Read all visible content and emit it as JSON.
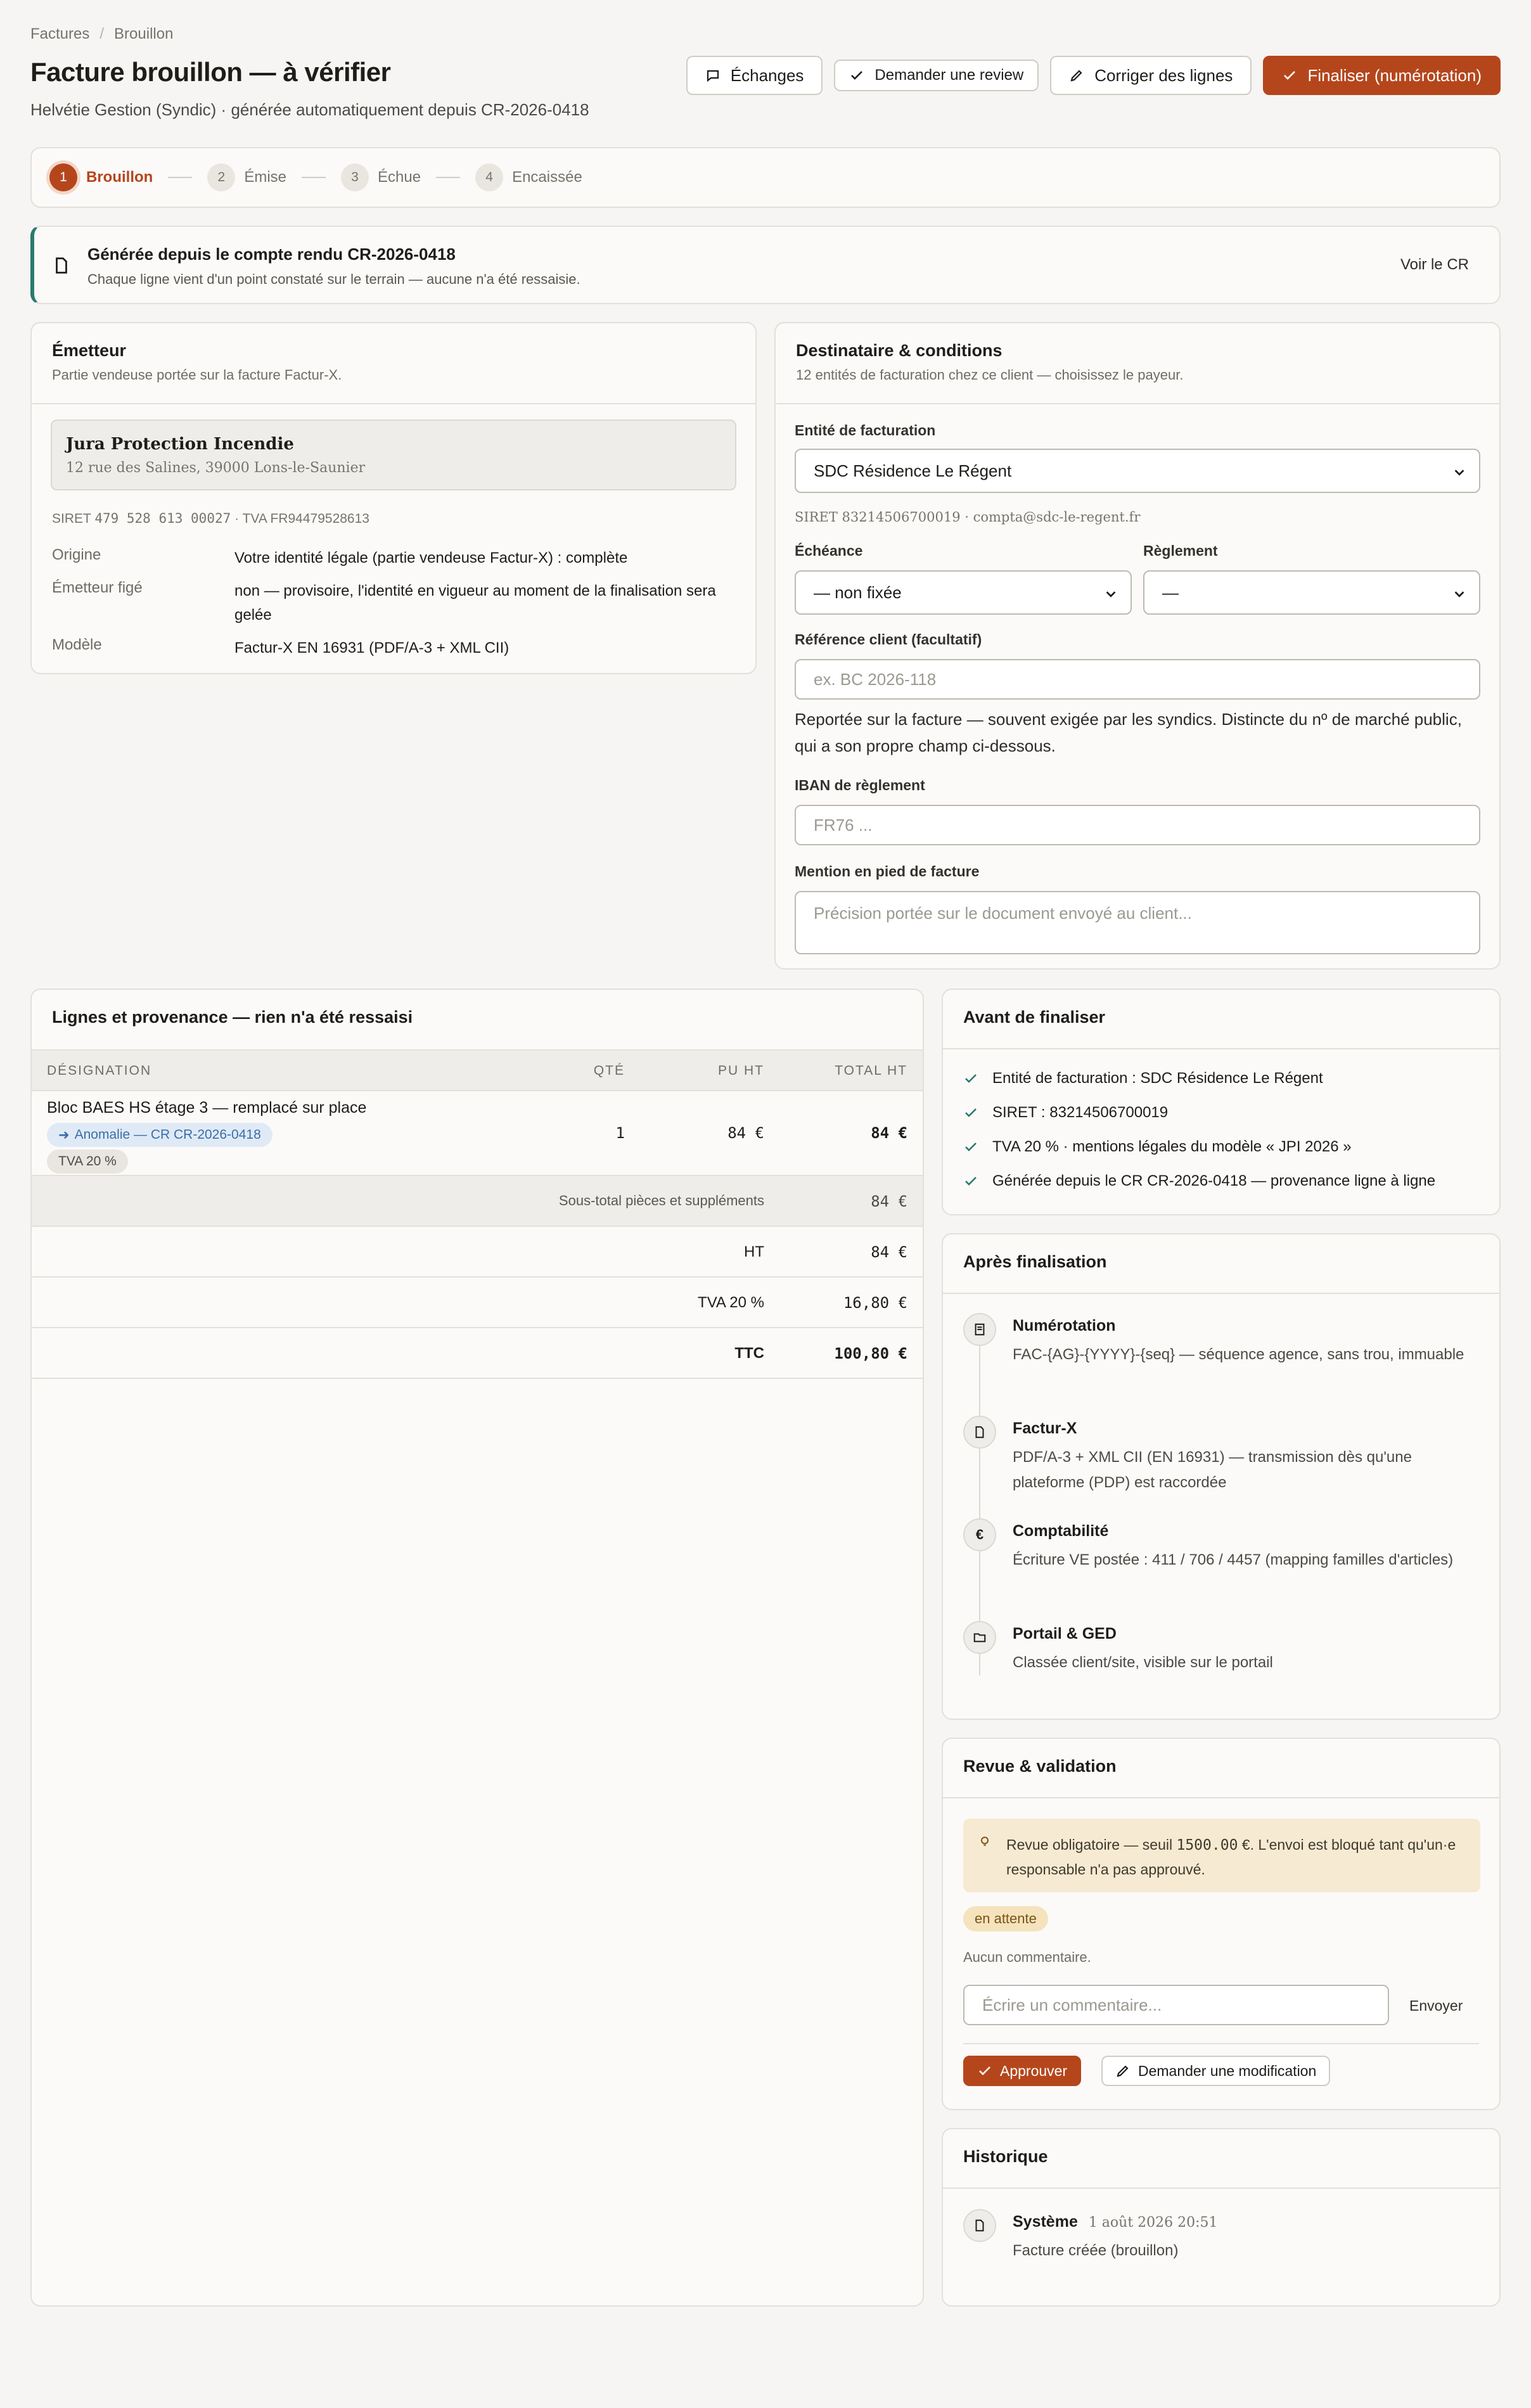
{
  "breadcrumb": {
    "root": "Factures",
    "current": "Brouillon"
  },
  "header": {
    "title": "Facture brouillon — à vérifier",
    "subtitle": "Helvétie Gestion (Syndic) · générée automatiquement depuis CR-2026-0418"
  },
  "toolbar": {
    "exchanges": "Échanges",
    "request_review": "Demander une review",
    "fix_lines": "Corriger des lignes",
    "finalize": "Finaliser (numérotation)"
  },
  "steps": [
    {
      "num": "1",
      "label": "Brouillon"
    },
    {
      "num": "2",
      "label": "Émise"
    },
    {
      "num": "3",
      "label": "Échue"
    },
    {
      "num": "4",
      "label": "Encaissée"
    }
  ],
  "banner": {
    "title": "Générée depuis le compte rendu CR-2026-0418",
    "text": "Chaque ligne vient d'un point constaté sur le terrain — aucune n'a été ressaisie.",
    "link": "Voir le CR"
  },
  "emitter": {
    "title": "Émetteur",
    "desc": "Partie vendeuse portée sur la facture Factur-X.",
    "company": "Jura Protection Incendie",
    "address": "12 rue des Salines, 39000 Lons-le-Saunier",
    "siret_label": "SIRET",
    "siret": "479 528 613 00027",
    "tva": "· TVA FR94479528613",
    "rows": [
      {
        "k": "Origine",
        "v": "Votre identité légale (partie vendeuse Factur-X) : complète"
      },
      {
        "k": "Émetteur figé",
        "v": "non — provisoire, l'identité en vigueur au moment de la finalisation sera gelée"
      },
      {
        "k": "Modèle",
        "v": "Factur-X EN 16931 (PDF/A-3 + XML CII)"
      }
    ]
  },
  "recipient": {
    "title": "Destinataire & conditions",
    "desc": "12 entités de facturation chez ce client — choisissez le payeur.",
    "entity_label": "Entité de facturation",
    "entity_value": "SDC Résidence Le Régent",
    "entity_meta": "SIRET 83214506700019 · compta@sdc-le-regent.fr",
    "due_label": "Échéance",
    "due_value": "— non fixée",
    "payment_label": "Règlement",
    "payment_value": "—",
    "ref_label": "Référence client (facultatif)",
    "ref_placeholder": "ex. BC 2026-118",
    "ref_hint": "Reportée sur la facture — souvent exigée par les syndics. Distincte du nº de marché public, qui a son propre champ ci-dessous.",
    "iban_label": "IBAN de règlement",
    "iban_placeholder": "FR76 ...",
    "footer_label": "Mention en pied de facture",
    "footer_placeholder": "Précision portée sur le document envoyé au client..."
  },
  "lines": {
    "title": "Lignes et provenance — rien n'a été ressaisi",
    "headers": {
      "designation": "DÉSIGNATION",
      "qty": "QTÉ",
      "pu": "PU HT",
      "total": "TOTAL HT"
    },
    "items": [
      {
        "designation": "Bloc BAES HS étage 3 — remplacé sur place",
        "origin": "Anomalie — CR CR-2026-0418",
        "vat": "TVA 20 %",
        "qty": "1",
        "pu": "84 €",
        "total": "84 €"
      }
    ],
    "subtotal_label": "Sous-total pièces et suppléments",
    "subtotal": "84 €",
    "ht_label": "HT",
    "ht": "84 €",
    "tva_label": "TVA 20 %",
    "tva": "16,80 €",
    "ttc_label": "TTC",
    "ttc": "100,80 €"
  },
  "checklist": {
    "title": "Avant de finaliser",
    "items": [
      "Entité de facturation : SDC Résidence Le Régent",
      "SIRET : 83214506700019",
      "TVA 20 % · mentions légales du modèle « JPI 2026 »",
      "Générée depuis le CR CR-2026-0418 — provenance ligne à ligne"
    ]
  },
  "after": {
    "title": "Après finalisation",
    "items": [
      {
        "icon": "numbering-icon",
        "title": "Numérotation",
        "desc": "FAC-{AG}-{YYYY}-{seq} — séquence agence, sans trou, immuable"
      },
      {
        "icon": "document-icon",
        "title": "Factur-X",
        "desc": "PDF/A-3 + XML CII (EN 16931) — transmission dès qu'une plateforme (PDP) est raccordée"
      },
      {
        "icon": "euro-icon",
        "title": "Comptabilité",
        "desc": "Écriture VE postée : 411 / 706 / 4457 (mapping familles d'articles)"
      },
      {
        "icon": "folder-icon",
        "title": "Portail & GED",
        "desc": "Classée client/site, visible sur le portail"
      }
    ]
  },
  "review": {
    "title": "Revue & validation",
    "alert_prefix": "Revue obligatoire — seuil ",
    "alert_amount": "1500.00",
    "alert_suffix": " €. L'envoi est bloqué tant qu'un·e responsable n'a pas approuvé.",
    "status": "en attente",
    "no_comment": "Aucun commentaire.",
    "comment_placeholder": "Écrire un commentaire...",
    "send": "Envoyer",
    "approve": "Approuver",
    "request_change": "Demander une modification"
  },
  "history": {
    "title": "Historique",
    "items": [
      {
        "actor": "Système",
        "date": "1 août 2026 20:51",
        "text": "Facture créée (brouillon)"
      }
    ]
  },
  "colors": {
    "accent": "#b5461c",
    "teal": "#2b7a6e",
    "check": "#2b7a6e"
  }
}
